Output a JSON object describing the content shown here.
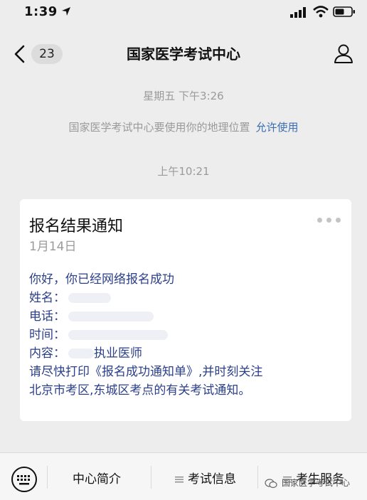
{
  "status_bar": {
    "time": "1:39"
  },
  "nav": {
    "back_badge": "23",
    "title": "国家医学考试中心"
  },
  "conversation": {
    "timestamp_1": "星期五 下午3:26",
    "location_notice": "国家医学考试中心要使用你的地理位置",
    "location_allow": "允许使用",
    "timestamp_2": "上午10:21"
  },
  "card": {
    "title": "报名结果通知",
    "date": "1月14日",
    "greeting": "你好，你已经网络报名成功",
    "name_label": "姓名：",
    "phone_label": "电话：",
    "time_label": "时间：",
    "content_label": "内容：",
    "content_value": "执业医师",
    "notice_line1": "请尽快打印《报名成功通知单》,并时刻关注",
    "notice_line2": "北京市考区,东城区考点的有关考试通知。"
  },
  "menu": {
    "tab1": "中心简介",
    "tab2": "考试信息",
    "tab3": "考生服务"
  },
  "watermark": "国家医学考试中心"
}
